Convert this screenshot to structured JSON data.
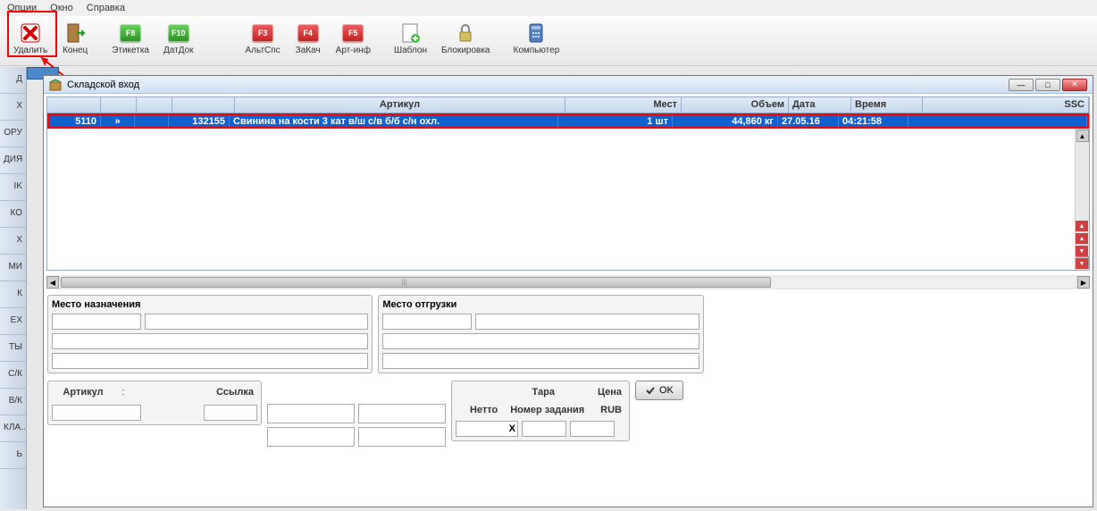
{
  "menu": {
    "opts": "Опции",
    "window": "Окно",
    "help": "Справка"
  },
  "toolbar": {
    "delete": "Удалить",
    "end": "Конец",
    "label_f8": "Этикетка",
    "f8": "F8",
    "datdok_f10": "ДатДок",
    "f10": "F10",
    "altspc_f3": "АльтСпс",
    "f3": "F3",
    "zakach_f4": "ЗаКач",
    "f4": "F4",
    "artinf_f5": "Арт-инф",
    "f5": "F5",
    "template": "Шаблон",
    "block": "Блокировка",
    "computer": "Компьютер"
  },
  "sidebar": [
    "Д",
    "Х",
    "ОРУ",
    "ДИЯ",
    "IK",
    "КО",
    "Х",
    "МИ",
    "К",
    "ЕХ",
    "ТЫ",
    "С/К",
    "В/К",
    "КЛА...",
    "Ь"
  ],
  "window_title": "Складской вход",
  "grid": {
    "headers": {
      "article": "Артикул",
      "place": "Мест",
      "volume": "Объем",
      "date": "Дата",
      "time": "Время",
      "ssc": "SSC"
    },
    "row": {
      "c1": "5110",
      "c2": "»",
      "c3": "132155",
      "desc": "Свинина на кости 3 кат в/ш с/в б/б с/н охл.",
      "place": "1 шт",
      "volume": "44,860 кг",
      "date": "27.05.16",
      "time": "04:21:58"
    }
  },
  "form": {
    "dest": "Место назначения",
    "ship": "Место отгрузки",
    "art": "Артикул",
    "colon": ":",
    "link": "Ссылка",
    "netto": "Нетто",
    "tare": "Тара",
    "price": "Цена",
    "task": "Номер задания",
    "currency": "RUB",
    "x": "X",
    "ok": "OK"
  }
}
